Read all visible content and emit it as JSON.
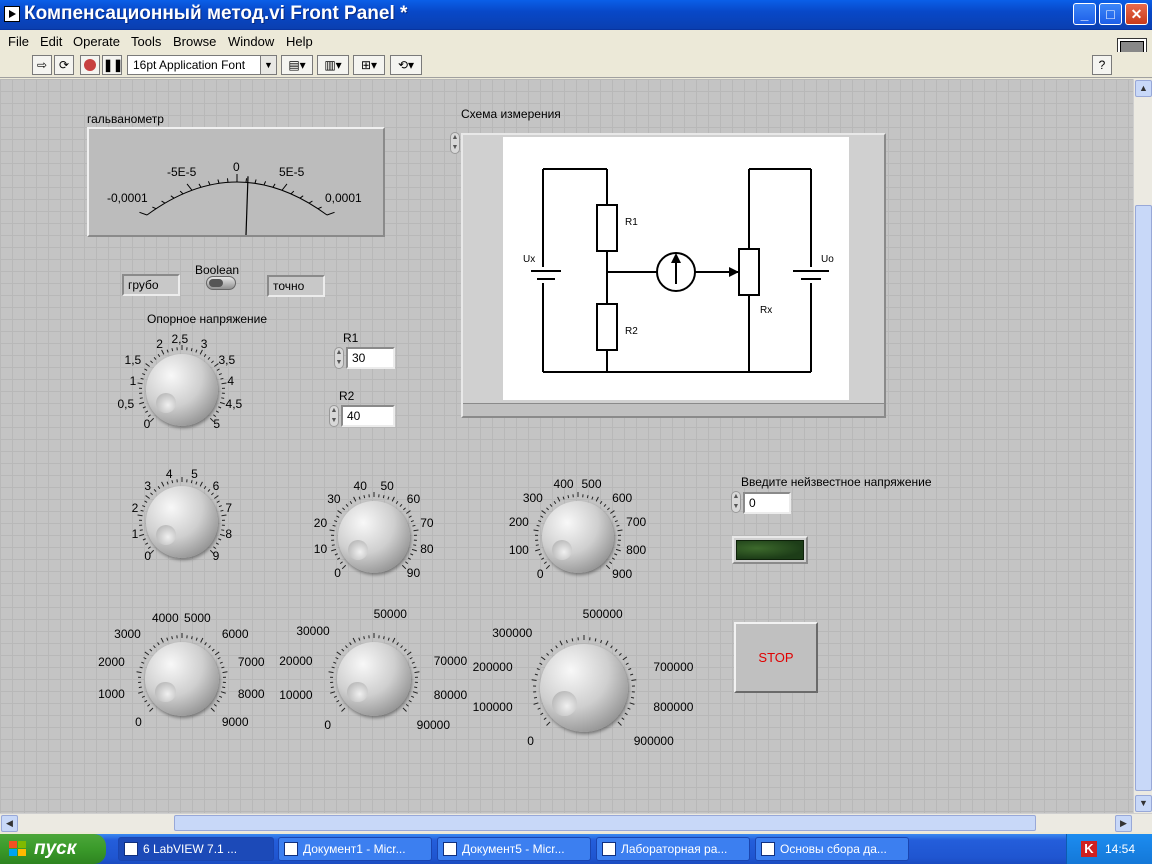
{
  "window": {
    "title": "Компенсационный метод.vi Front Panel *",
    "buttons": {
      "minimize": "_",
      "maximize": "□",
      "close": "✕"
    }
  },
  "menu": [
    "File",
    "Edit",
    "Operate",
    "Tools",
    "Browse",
    "Window",
    "Help"
  ],
  "toolbar": {
    "font": "16pt Application Font",
    "help": "?"
  },
  "gauge": {
    "label": "гальванометр",
    "scale": [
      "-0,0001",
      "-5E-5",
      "0",
      "5E-5",
      "0,0001"
    ],
    "value": 1e-05
  },
  "switch": {
    "label": "Boolean",
    "left_text": "грубо",
    "right_text": "точно"
  },
  "knobs": {
    "ref_voltage": {
      "label": "Опорное напряжение",
      "ticks": [
        "0",
        "0,5",
        "1",
        "1,5",
        "2",
        "2,5",
        "3",
        "3,5",
        "4",
        "4,5",
        "5"
      ]
    },
    "k1": {
      "ticks": [
        "0",
        "1",
        "2",
        "3",
        "4",
        "5",
        "6",
        "7",
        "8",
        "9"
      ]
    },
    "k10": {
      "ticks": [
        "0",
        "10",
        "20",
        "30",
        "40",
        "50",
        "60",
        "70",
        "80",
        "90"
      ]
    },
    "k100": {
      "ticks": [
        "0",
        "100",
        "200",
        "300",
        "400",
        "500",
        "600",
        "700",
        "800",
        "900"
      ]
    },
    "k1000": {
      "ticks": [
        "0",
        "1000",
        "2000",
        "3000",
        "4000",
        "5000",
        "6000",
        "7000",
        "8000",
        "9000"
      ]
    },
    "k10000": {
      "ticks": [
        "0",
        "10000",
        "20000",
        "30000",
        "50000",
        "70000",
        "80000",
        "90000"
      ]
    },
    "k100000": {
      "ticks": [
        "0",
        "100000",
        "200000",
        "300000",
        "500000",
        "700000",
        "800000",
        "900000"
      ]
    }
  },
  "r1": {
    "label": "R1",
    "value": "30"
  },
  "r2": {
    "label": "R2",
    "value": "40"
  },
  "scheme": {
    "label": "Схема измерения",
    "labels": {
      "ux": "Ux",
      "r1": "R1",
      "r2": "R2",
      "rx": "Rx",
      "uo": "Uo"
    }
  },
  "unknown_voltage": {
    "label": "Введите нейзвестное напряжение",
    "value": "0"
  },
  "stop": {
    "label": "STOP"
  },
  "taskbar": {
    "start": "пуск",
    "tasks": [
      {
        "label": "6 LabVIEW 7.1 ...",
        "active": true
      },
      {
        "label": "Документ1 - Micr...",
        "active": false
      },
      {
        "label": "Документ5 - Micr...",
        "active": false
      },
      {
        "label": "Лабораторная ра...",
        "active": false
      },
      {
        "label": "Основы сбора да...",
        "active": false
      }
    ],
    "tray_icon": "K",
    "clock": "14:54"
  },
  "colors": {
    "panel_bg": "#c4c4c4",
    "titlebar": "#0a5fe8",
    "led_off": "#2d5020",
    "stop_text": "#e00000"
  }
}
